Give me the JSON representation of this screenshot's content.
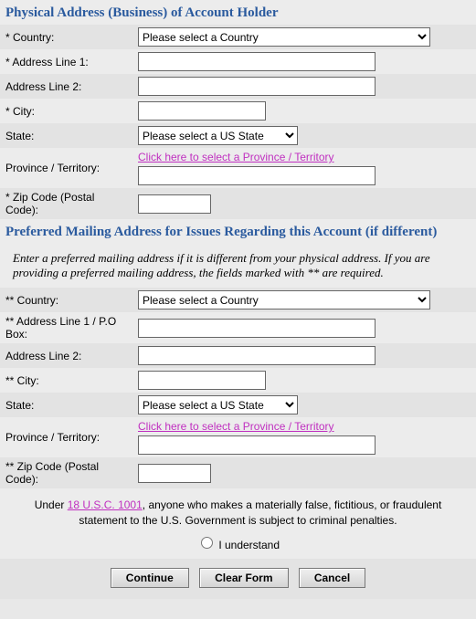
{
  "physical": {
    "header": "Physical Address (Business) of Account Holder",
    "country": {
      "label": "* Country:",
      "selected": "Please select a Country"
    },
    "addr1": {
      "label": "* Address Line 1:",
      "value": ""
    },
    "addr2": {
      "label": "Address Line 2:",
      "value": ""
    },
    "city": {
      "label": "* City:",
      "value": ""
    },
    "state": {
      "label": "State:",
      "selected": "Please select a US State"
    },
    "province": {
      "label": "Province / Territory:",
      "link": "Click here to select a Province / Territory",
      "value": ""
    },
    "zip": {
      "label": "* Zip Code (Postal Code):",
      "value": ""
    }
  },
  "mailing": {
    "header": "Preferred Mailing Address for Issues Regarding this Account (if different)",
    "instruction": "Enter a preferred mailing address if it is different from your physical address. If you are providing a preferred mailing address, the fields marked with ** are required.",
    "country": {
      "label": "** Country:",
      "selected": "Please select a Country"
    },
    "addr1": {
      "label": "** Address Line 1 / P.O Box:",
      "value": ""
    },
    "addr2": {
      "label": "Address Line 2:",
      "value": ""
    },
    "city": {
      "label": "** City:",
      "value": ""
    },
    "state": {
      "label": "State:",
      "selected": "Please select a US State"
    },
    "province": {
      "label": "Province / Territory:",
      "link": "Click here to select a Province / Territory",
      "value": ""
    },
    "zip": {
      "label": "** Zip Code (Postal Code):",
      "value": ""
    }
  },
  "legal": {
    "prefix": "Under ",
    "link": "18 U.S.C. 1001",
    "suffix": ", anyone who makes a materially false, fictitious, or fraudulent statement to the U.S. Government is subject to criminal penalties.",
    "understand": "I understand"
  },
  "buttons": {
    "continue": "Continue",
    "clear": "Clear Form",
    "cancel": "Cancel"
  }
}
